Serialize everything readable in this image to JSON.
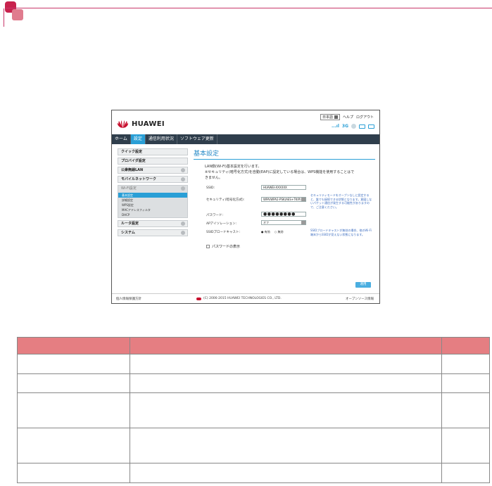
{
  "screenshot": {
    "top_links": {
      "language": "日本語",
      "help": "ヘルプ",
      "logout": "ログアウト"
    },
    "status": {
      "signal": "...ıl",
      "network": "3G"
    },
    "brand": "HUAWEI",
    "nav": [
      "ホーム",
      "設定",
      "通信利用状況",
      "ソフトウェア更新"
    ],
    "sidebar": {
      "items_top": [
        "クイック設定",
        "プロバイダ設定",
        "公衆無線LAN",
        "モバイルネットワーク"
      ],
      "wifi_group": "Wi-Fi設定",
      "wifi_sub": [
        "基本設定",
        "詳細設定",
        "WPS設定",
        "MACアドレスフィルタ",
        "DHCP"
      ],
      "items_bottom": [
        "ルータ設定",
        "システム"
      ]
    },
    "content": {
      "title": "基本設定",
      "desc_line1": "LAN側(Wi-Fi)基本設定を行います。",
      "desc_line2": "※セキュリティ(暗号化方式)を自動(EAP)に設定している場合は、WPS機能を使用することはで",
      "desc_line3": "きません。",
      "ssid_label": "SSID:",
      "ssid_value": "HUAWEI-XXXXXX",
      "security_label": "セキュリティ(暗号化方式):",
      "security_value": "WPA/WPA2-PSK(AES+TKIP)",
      "security_note": "セキュリティモードをオープンなしに設定すると、誰でも接続できる状態となります。意図しないパケット通信が発生する可能性がありますので、ご注意ください。",
      "password_label": "パスワード:",
      "password_value": "●●●●●●●●",
      "isolation_label": "APアイソレーション:",
      "isolation_value": "オフ",
      "broadcast_label": "SSIDブロードキャスト:",
      "broadcast_on": "有効",
      "broadcast_off": "無効",
      "broadcast_note": "SSIDブロードキャストが無効の場合、他のWi-Fi端末からSSIDが見えない状態になります。",
      "show_password": "パスワードの表示",
      "apply": "適用"
    },
    "footer": {
      "left": "個人情報保護方針",
      "center": "(C) 2006-2015 HUAWEI TECHNOLOGIES CO., LTD.",
      "right": "オープンソース情報"
    }
  }
}
